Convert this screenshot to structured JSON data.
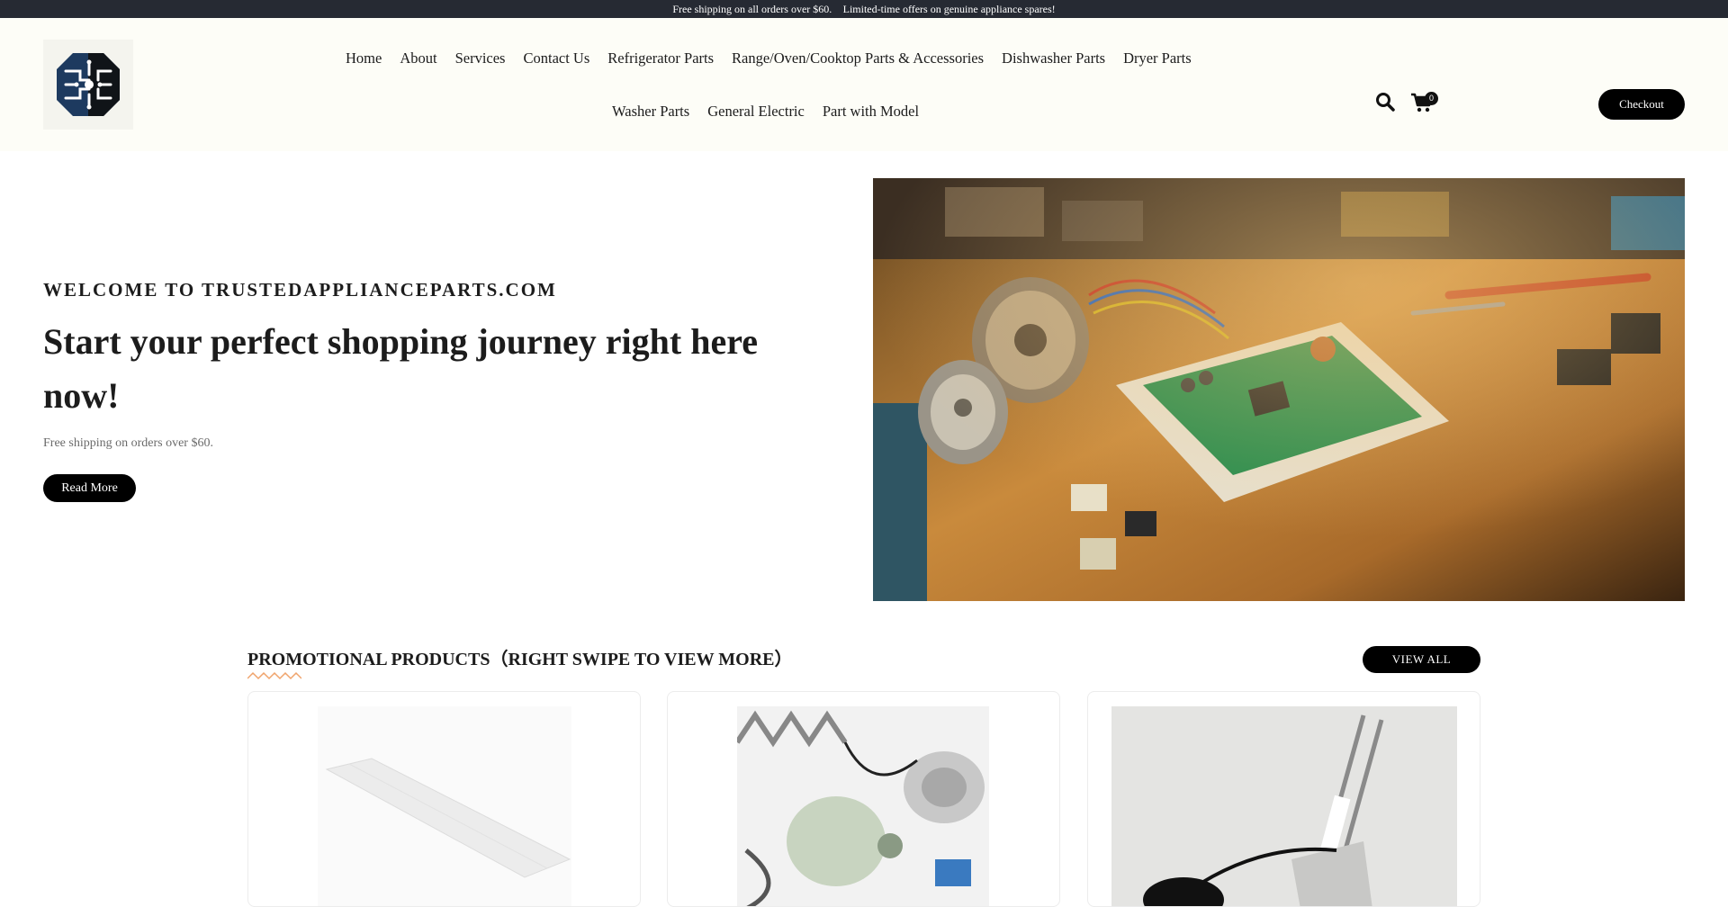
{
  "announcement": "Free shipping on all orders over $60. \u0000Limited-time offers on genuine appliance spares!",
  "nav": {
    "row1": [
      "Home",
      "About",
      "Services",
      "Contact Us",
      "Refrigerator Parts",
      "Range/Oven/Cooktop Parts & Accessories",
      "Dishwasher Parts",
      "Dryer Parts"
    ],
    "row2": [
      "Washer Parts",
      "General Electric",
      "Part with Model"
    ]
  },
  "cart": {
    "count": "0"
  },
  "checkout_label": "Checkout",
  "hero": {
    "eyebrow": "WELCOME TO TRUSTEDAPPLIANCEPARTS.COM",
    "title": "Start your perfect shopping journey right here now!",
    "subtitle": "Free shipping on orders over $60.",
    "button": "Read More"
  },
  "promo": {
    "title": "PROMOTIONAL PRODUCTS（RIGHT SWIPE TO VIEW MORE）",
    "view_all": "VIEW ALL"
  },
  "icons": {
    "logo": "circuit-logo-icon",
    "search": "search-icon",
    "cart": "cart-icon"
  },
  "colors": {
    "topbar": "#262a33",
    "header_bg": "#fdfdf7",
    "button": "#000000",
    "accent": "#f0a46c"
  }
}
